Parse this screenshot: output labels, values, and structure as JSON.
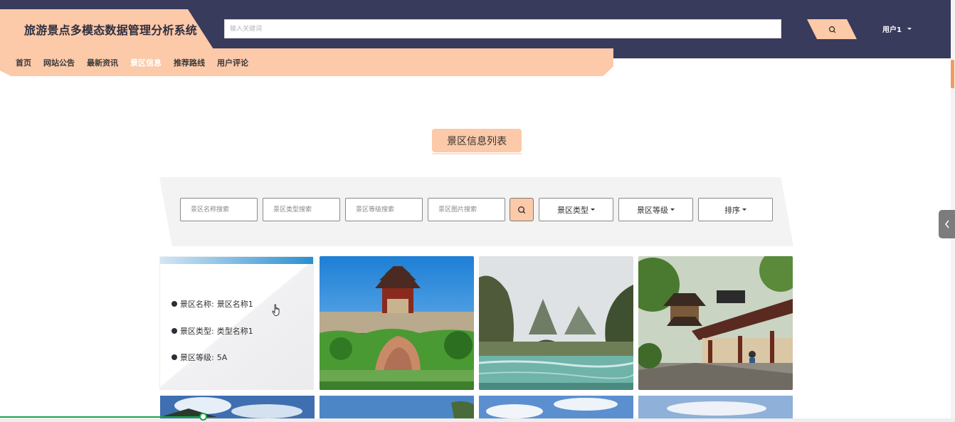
{
  "header": {
    "app_title": "旅游景点多模态数据管理分析系统",
    "search_placeholder": "输入关键词",
    "search_icon": "search-icon",
    "user_label": "用户1"
  },
  "nav": {
    "items": [
      {
        "label": "首页",
        "active": false
      },
      {
        "label": "网站公告",
        "active": false
      },
      {
        "label": "最新资讯",
        "active": false
      },
      {
        "label": "景区信息",
        "active": true
      },
      {
        "label": "推荐路线",
        "active": false
      },
      {
        "label": "用户评论",
        "active": false
      }
    ]
  },
  "section": {
    "title": "景区信息列表"
  },
  "filters": {
    "name_placeholder": "景区名称搜索",
    "type_placeholder": "景区类型搜索",
    "level_placeholder": "景区等级搜索",
    "image_placeholder": "景区图片搜索",
    "type_dropdown": "景区类型",
    "level_dropdown": "景区等级",
    "sort_dropdown": "排序"
  },
  "cards": {
    "first": {
      "name_label": "景区名称:",
      "name_value": "景区名称1",
      "type_label": "景区类型:",
      "type_value": "类型名称1",
      "level_label": "景区等级:",
      "level_value": "5A"
    }
  },
  "colors": {
    "header_bg": "#383b5b",
    "accent": "#fcc9a9",
    "scroll_thumb": "#f19b62",
    "progress": "#1aa34a"
  }
}
